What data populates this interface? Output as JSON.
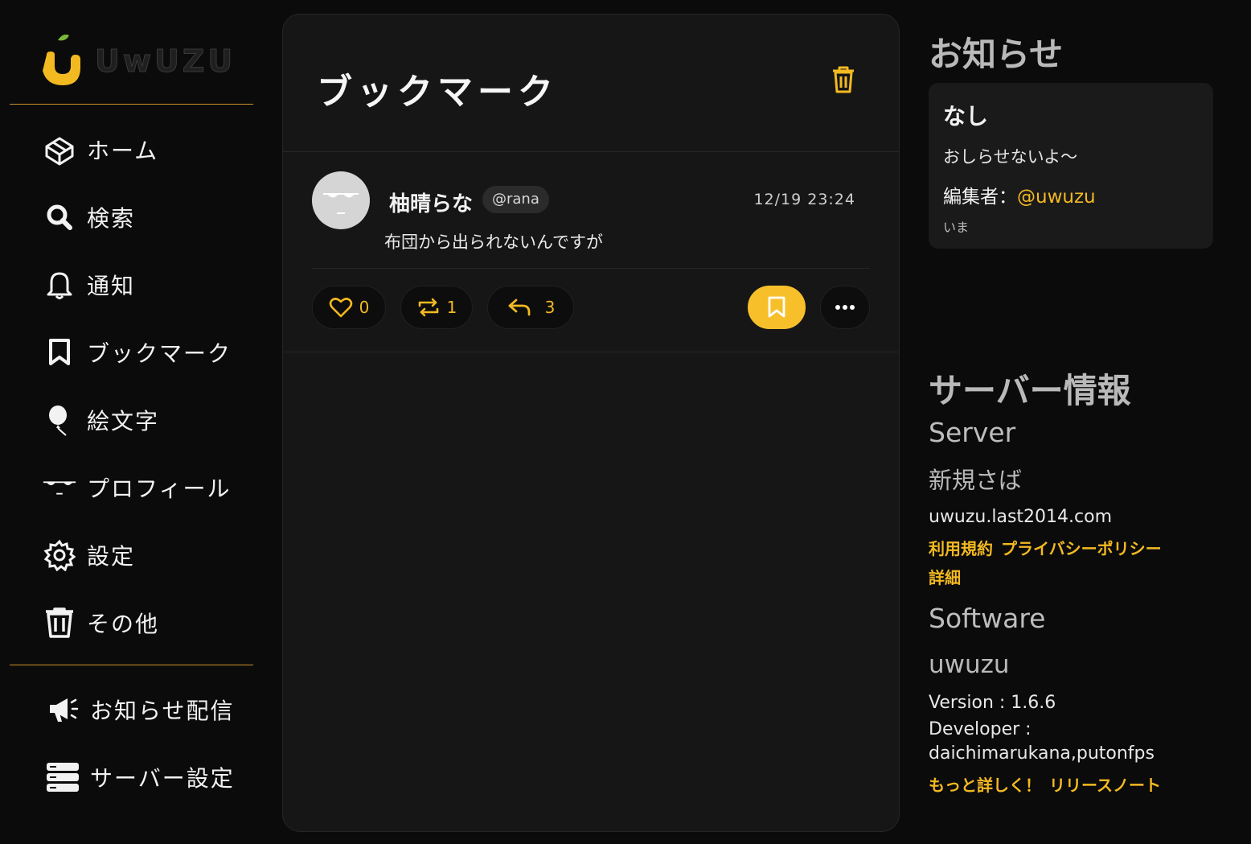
{
  "app": {
    "logo_text": "UwUZU"
  },
  "sidebar": {
    "items": [
      {
        "label": "ホーム",
        "icon": "home-box-icon"
      },
      {
        "label": "検索",
        "icon": "search-icon"
      },
      {
        "label": "通知",
        "icon": "bell-icon"
      },
      {
        "label": "ブックマーク",
        "icon": "bookmark-icon"
      },
      {
        "label": "絵文字",
        "icon": "balloon-icon"
      },
      {
        "label": "プロフィール",
        "icon": "face-icon"
      },
      {
        "label": "設定",
        "icon": "gear-icon"
      },
      {
        "label": "その他",
        "icon": "trash-icon"
      }
    ],
    "admin_items": [
      {
        "label": "お知らせ配信",
        "icon": "megaphone-icon"
      },
      {
        "label": "サーバー設定",
        "icon": "server-icon"
      }
    ]
  },
  "main": {
    "title": "ブックマーク",
    "posts": [
      {
        "author": "柚晴らな",
        "handle": "@rana",
        "time": "12/19 23:24",
        "text": "布団から出られないんですが",
        "likes": "0",
        "reposts": "1",
        "replies": "3",
        "bookmarked": true
      }
    ]
  },
  "notice": {
    "heading": "お知らせ",
    "title": "なし",
    "body": "おしらせないよ～",
    "editor_label": "編集者：",
    "editor_handle": "@uwuzu",
    "time": "いま"
  },
  "server_info": {
    "heading": "サーバー情報",
    "server_label": "Server",
    "server_name": "新規さば",
    "domain": "uwuzu.last2014.com",
    "links": [
      "利用規約",
      "プライバシーポリシー",
      "詳細"
    ],
    "software_label": "Software",
    "software_name": "uwuzu",
    "version": "Version : 1.6.6",
    "developer_label": "Developer :",
    "developer": "daichimarukana,putonfps",
    "software_links": [
      "もっと詳しく！",
      "リリースノート"
    ]
  },
  "colors": {
    "accent": "#f3b921",
    "panel": "#161617",
    "background": "#0b0b0b"
  }
}
